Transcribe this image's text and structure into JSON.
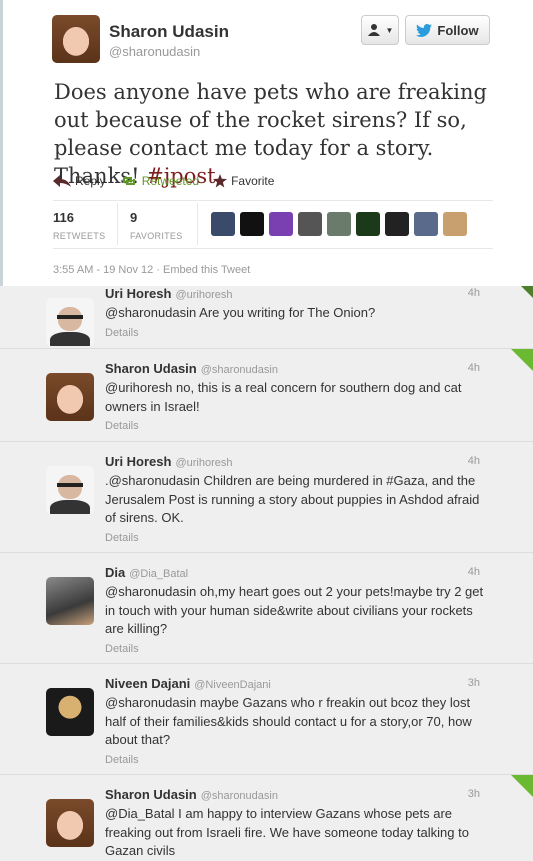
{
  "main_tweet": {
    "author_name": "Sharon Udasin",
    "author_handle": "@sharonudasin",
    "follow_label": "Follow",
    "text_parts": [
      "Does anyone have pets who are freaking out because of the rocket sirens? If so, please contact me today for a story. Thanks! ",
      "#jpost"
    ],
    "actions": {
      "reply": "Reply",
      "retweeted": "Retweeted",
      "favorite": "Favorite"
    },
    "stats": {
      "retweets_count": "116",
      "retweets_label": "RETWEETS",
      "favorites_count": "9",
      "favorites_label": "FAVORITES"
    },
    "timestamp": "3:55 AM - 19 Nov 12 · Embed this Tweet"
  },
  "favoriter_colors": [
    "#3a4a6a",
    "#111111",
    "#7a3fb0",
    "#555555",
    "#6b7b6b",
    "#1a3a1a",
    "#222222",
    "#5a6a8a",
    "#c8a070"
  ],
  "replies": [
    {
      "name": "Uri Horesh",
      "handle": "@urihoresh",
      "time": "4h",
      "text": "@sharonudasin Are you writing for The Onion?",
      "details": "Details",
      "avatar": "man"
    },
    {
      "name": "Sharon Udasin",
      "handle": "@sharonudasin",
      "time": "4h",
      "text": "@urihoresh no, this is a real concern for southern dog and cat owners in Israel!",
      "details": "Details",
      "avatar": "woman"
    },
    {
      "name": "Uri Horesh",
      "handle": "@urihoresh",
      "time": "4h",
      "text": ".@sharonudasin Children are being murdered in #Gaza, and the Jerusalem Post is running a story about puppies in Ashdod afraid of sirens. OK.",
      "details": "Details",
      "avatar": "man"
    },
    {
      "name": "Dia",
      "handle": "@Dia_Batal",
      "time": "4h",
      "text": "@sharonudasin oh,my heart goes out 2 your pets!maybe try 2 get in touch with your human side&write about civilians your rockets are killing?",
      "details": "Details",
      "avatar": "dia"
    },
    {
      "name": "Niveen Dajani",
      "handle": "@NiveenDajani",
      "time": "3h",
      "text": "@sharonudasin maybe Gazans who r freakin out bcoz they lost half of their families&kids should contact u for a story,or 70, how about that?",
      "details": "Details",
      "avatar": "niveen"
    },
    {
      "name": "Sharon Udasin",
      "handle": "@sharonudasin",
      "time": "3h",
      "text": "@Dia_Batal I am happy to interview Gazans whose pets are freaking out from Israeli fire. We have someone today talking to Gazan civils",
      "details": "",
      "avatar": "woman"
    }
  ]
}
